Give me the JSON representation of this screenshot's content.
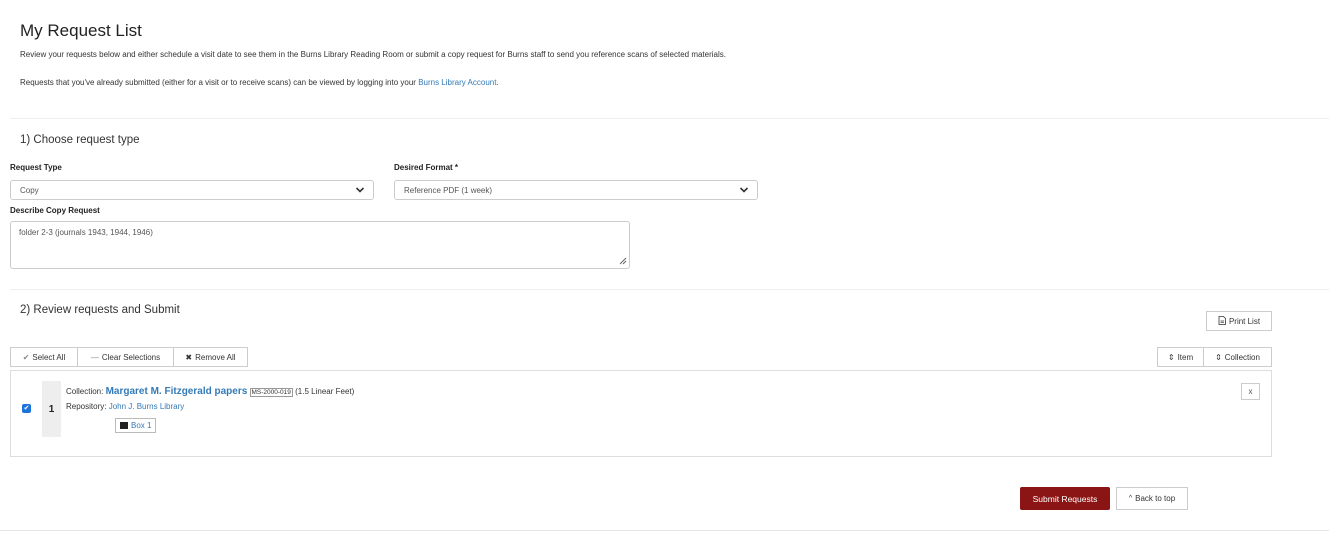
{
  "page": {
    "title": "My Request List",
    "intro_1": "Review your requests below and either schedule a visit date to see them in the Burns Library Reading Room or submit a copy request for Burns staff to send you reference scans of selected materials.",
    "intro_2_prefix": "Requests that you've already submitted (either for a visit or to receive scans) can be viewed by logging into your ",
    "intro_2_link": "Burns Library Account",
    "intro_2_suffix": "."
  },
  "step1": {
    "heading": "1) Choose request type",
    "request_type_label": "Request Type",
    "request_type_value": "Copy",
    "desired_format_label": "Desired Format *",
    "desired_format_value": "Reference PDF (1 week)",
    "describe_label": "Describe Copy Request",
    "describe_value": "folder 2-3 (journals 1943, 1944, 1946)"
  },
  "step2": {
    "heading": "2) Review requests and Submit",
    "print_list": "Print List",
    "select_all": "Select All",
    "clear_selections": "Clear Selections",
    "remove_all": "Remove All",
    "sort_item": "Item",
    "sort_collection": "Collection"
  },
  "request_items": [
    {
      "number": "1",
      "checked": true,
      "collection_label": "Collection: ",
      "collection_title": "Margaret M. Fitzgerald papers",
      "identifier": "MS-2000-019",
      "extent": "(1.5 Linear Feet)",
      "repository_label": "Repository: ",
      "repository_name": "John J. Burns Library",
      "container": "Box 1",
      "remove_label": "x"
    }
  ],
  "footer": {
    "submit": "Submit Requests",
    "back_to_top": "Back to top"
  },
  "icons": {
    "check": "✔",
    "minus": "—",
    "times": "✖",
    "sort": "⇕",
    "print": "print-icon",
    "chevron": "chevron-down-icon",
    "chevron_up": "^"
  },
  "colors": {
    "link": "#337ab7",
    "submit_bg": "#8b1414",
    "checkbox": "#1e73d8"
  }
}
